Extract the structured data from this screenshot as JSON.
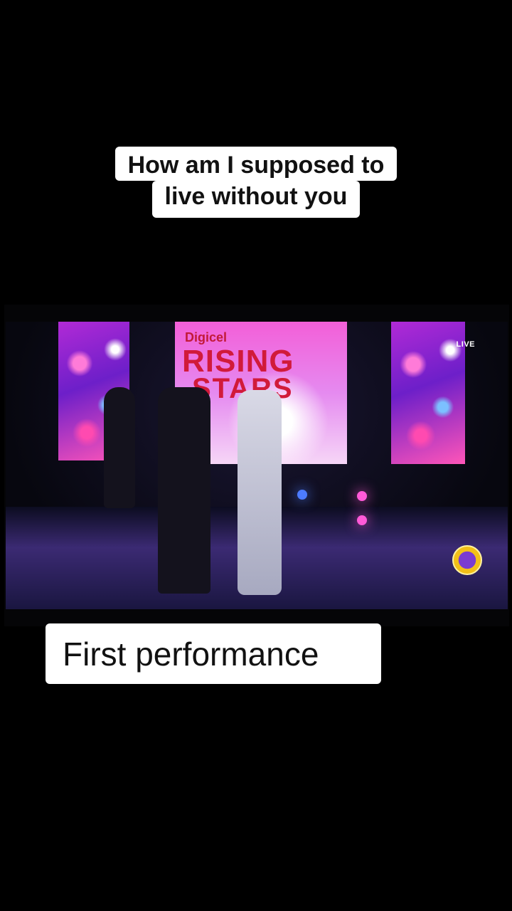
{
  "caption_top": {
    "lines": [
      "How am I supposed to",
      "live without you"
    ]
  },
  "video": {
    "live_badge": "LIVE",
    "stage_screen": {
      "brand": "Digicel",
      "title_line1": "RISING",
      "title_line2": "STARS"
    }
  },
  "caption_bottom": {
    "text": "First performance"
  },
  "colors": {
    "background": "#000000",
    "caption_bg": "#ffffff",
    "caption_text": "#111111"
  }
}
